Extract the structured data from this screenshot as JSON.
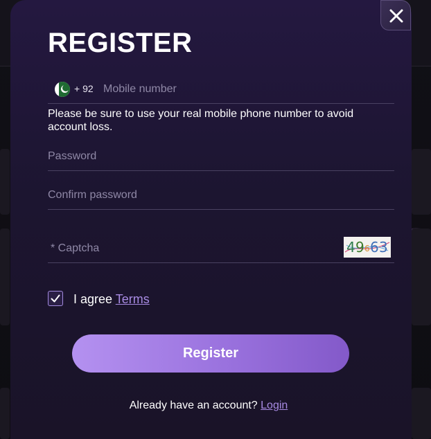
{
  "modal": {
    "title": "REGISTER",
    "close_icon": "close-icon"
  },
  "phone": {
    "flag_icon": "pakistan-flag-icon",
    "country_code": "+ 92",
    "placeholder": "Mobile number",
    "value": ""
  },
  "hint": "Please be sure to use your real mobile phone number to avoid account loss.",
  "password": {
    "placeholder": "Password",
    "value": ""
  },
  "confirm_password": {
    "placeholder": "Confirm password",
    "value": ""
  },
  "captcha": {
    "placeholder": "* Captcha",
    "value": "",
    "image_text": "4963"
  },
  "agree": {
    "checked": true,
    "label": "I agree",
    "terms_link": "Terms"
  },
  "register_button": "Register",
  "login": {
    "prompt": "Already have an account?",
    "link": "Login"
  },
  "colors": {
    "accent": "#a88be3",
    "button_gradient_start": "#b491f0",
    "button_gradient_end": "#8359c9",
    "modal_bg": "#1c1530"
  }
}
